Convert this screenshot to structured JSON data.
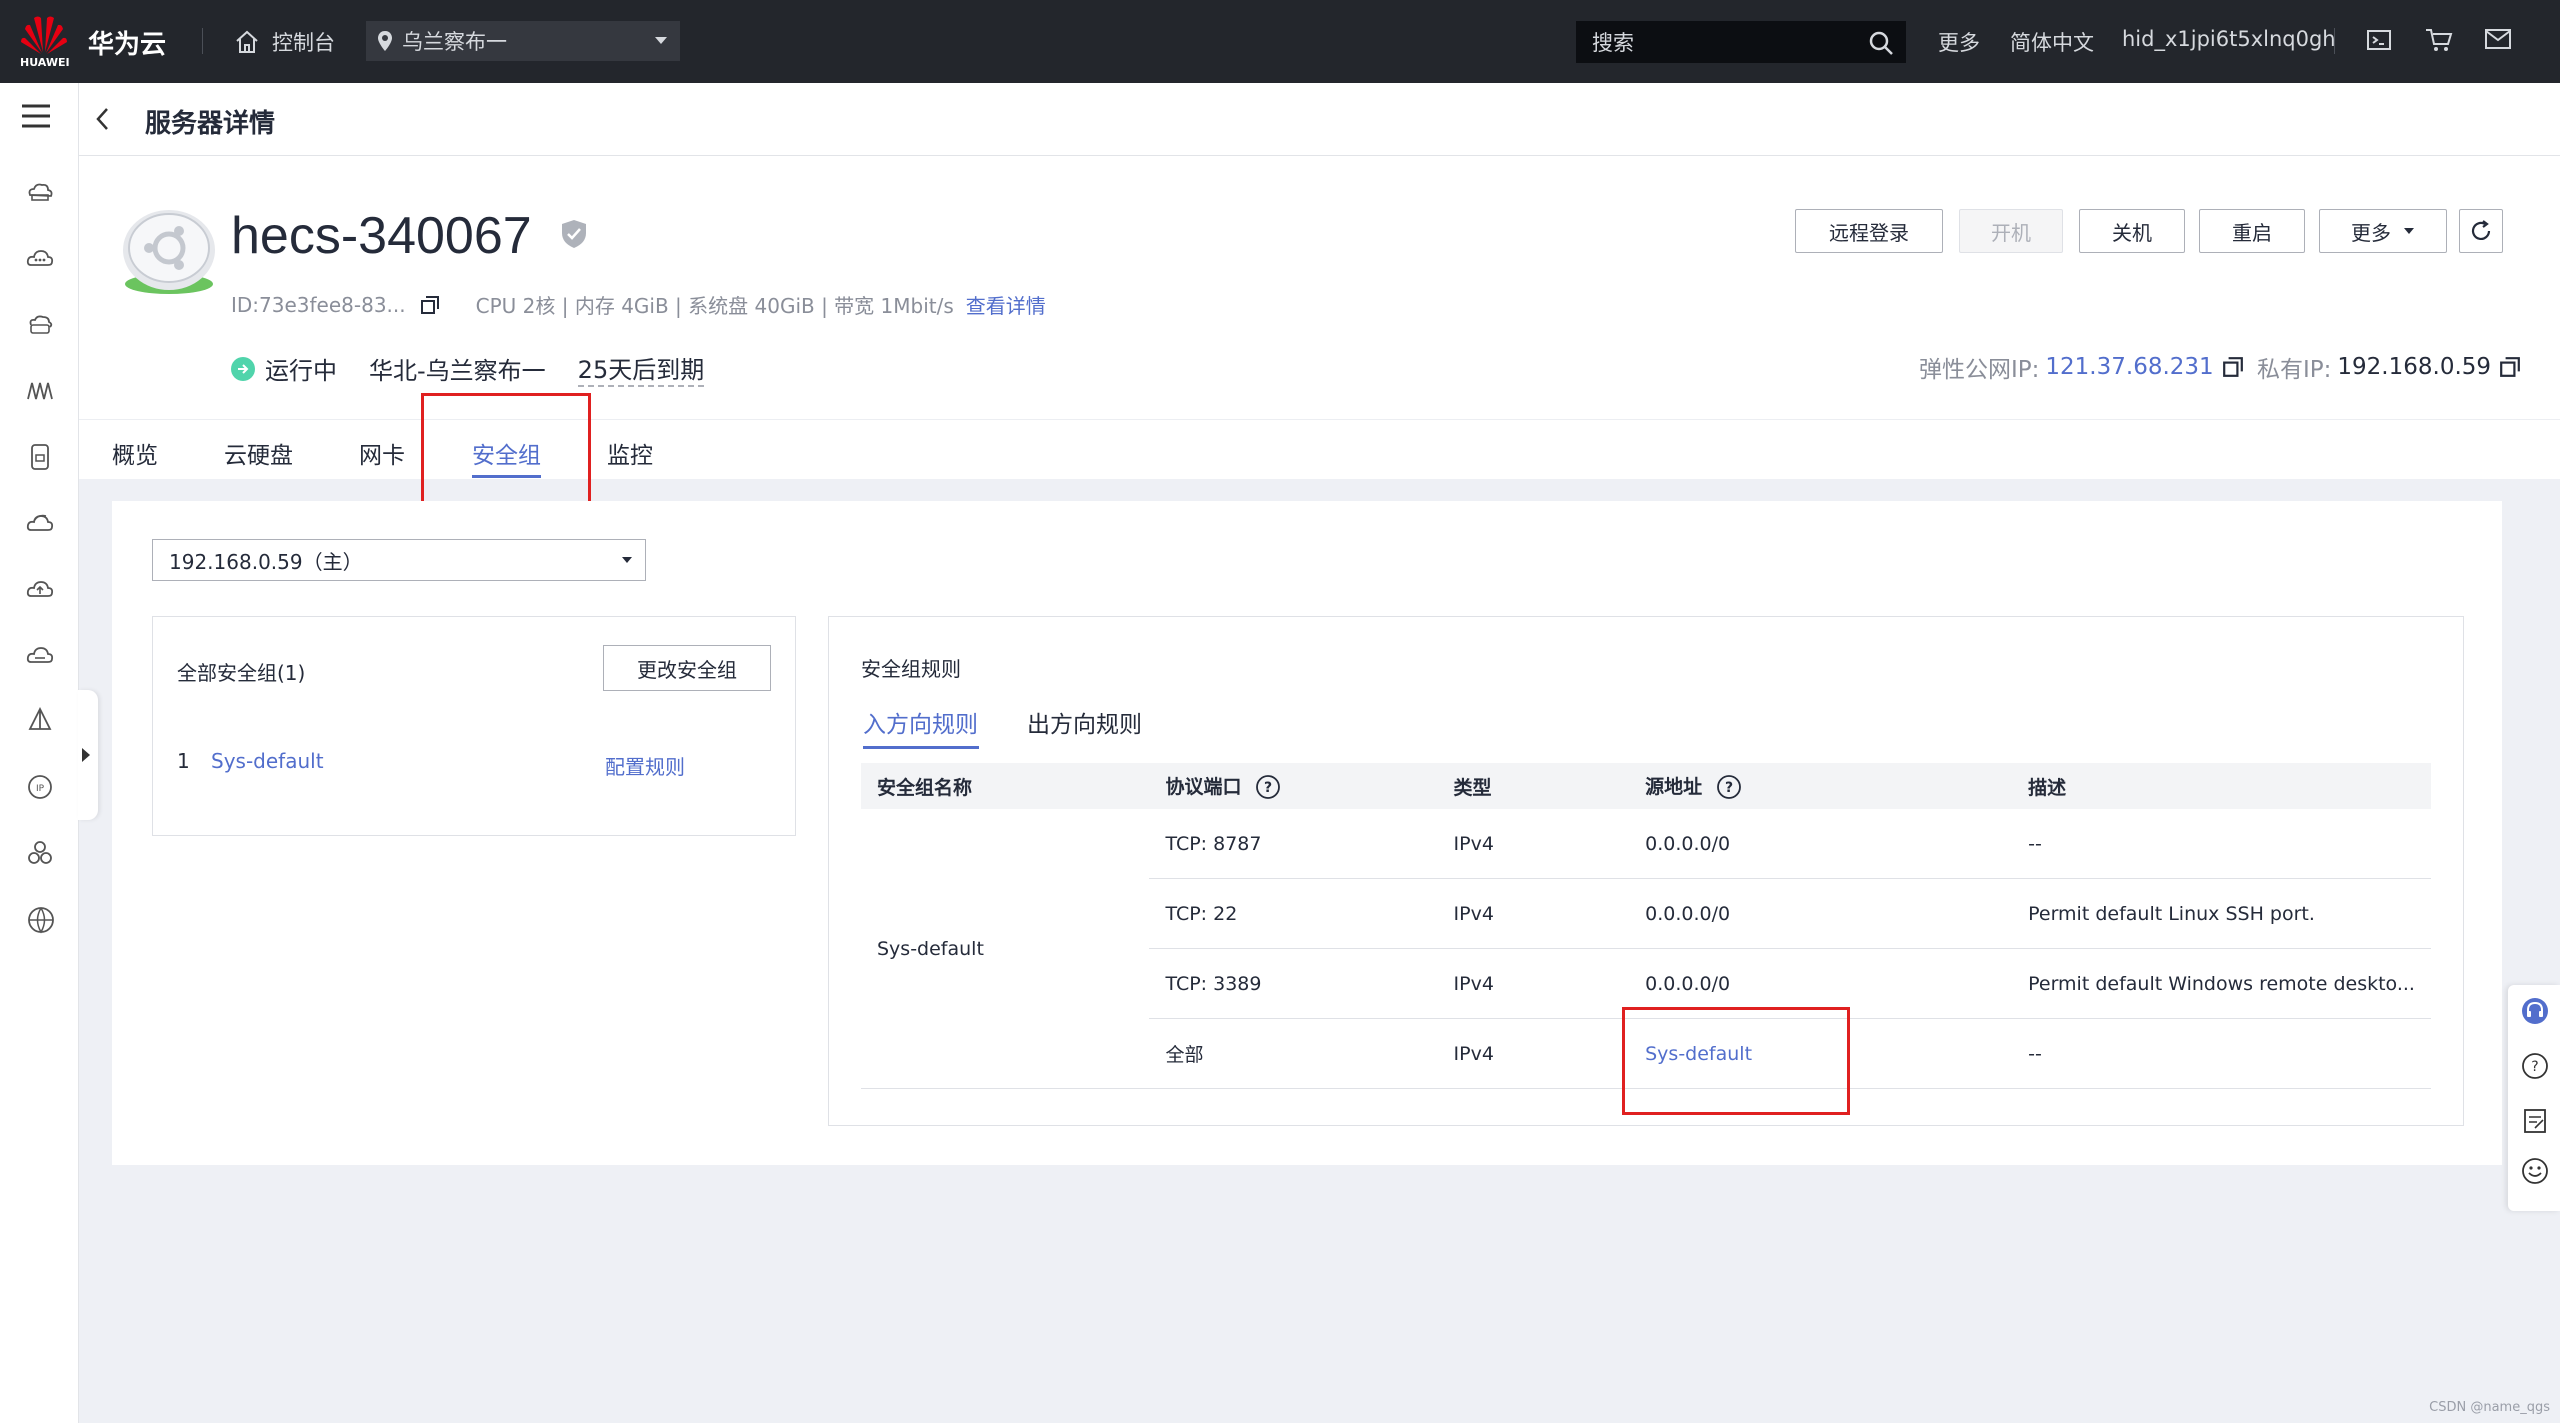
{
  "topbar": {
    "brand": "华为云",
    "logo_text": "HUAWEI",
    "console": "控制台",
    "region": "乌兰察布一",
    "search_placeholder": "搜索",
    "more": "更多",
    "language": "简体中文",
    "user": "hid_x1jpi6t5xlnq0gh",
    "icons": [
      "terminal-icon",
      "cart-icon",
      "mail-icon"
    ]
  },
  "header": {
    "title": "服务器详情"
  },
  "instance": {
    "name": "hecs-340067",
    "id": "ID:73e3fee8-83...",
    "spec": "CPU 2核 | 内存 4GiB | 系统盘 40GiB | 带宽 1Mbit/s",
    "details_link": "查看详情",
    "status": "运行中",
    "region": "华北-乌兰察布一",
    "expiry": "25天后到期",
    "eip_label": "弹性公网IP:",
    "eip": "121.37.68.231",
    "private_ip_label": "私有IP:",
    "private_ip": "192.168.0.59"
  },
  "actions": {
    "remote_login": "远程登录",
    "start": "开机",
    "stop": "关机",
    "restart": "重启",
    "more": "更多"
  },
  "tabs": [
    "概览",
    "云硬盘",
    "网卡",
    "安全组",
    "监控"
  ],
  "active_tab": "安全组",
  "nic_select": "192.168.0.59（主）",
  "sg_panel": {
    "header": "全部安全组(1)",
    "change_button": "更改安全组",
    "items": [
      {
        "index": "1",
        "name": "Sys-default",
        "action": "配置规则"
      }
    ]
  },
  "rules": {
    "title": "安全组规则",
    "tabs": [
      "入方向规则",
      "出方向规则"
    ],
    "columns": [
      "安全组名称",
      "协议端口",
      "类型",
      "源地址",
      "描述"
    ],
    "group_name": "Sys-default",
    "rows": [
      {
        "port": "TCP: 8787",
        "type": "IPv4",
        "source": "0.0.0.0/0",
        "desc": "--"
      },
      {
        "port": "TCP: 22",
        "type": "IPv4",
        "source": "0.0.0.0/0",
        "desc": "Permit default Linux SSH port."
      },
      {
        "port": "TCP: 3389",
        "type": "IPv4",
        "source": "0.0.0.0/0",
        "desc": "Permit default Windows remote deskto..."
      },
      {
        "port": "全部",
        "type": "IPv4",
        "source": "Sys-default",
        "desc": "--"
      }
    ]
  },
  "watermark": "CSDN @name_qgs",
  "colors": {
    "accent": "#526ecc",
    "topbar": "#23262c",
    "highlight": "#e02020",
    "running": "#50d4ab"
  }
}
